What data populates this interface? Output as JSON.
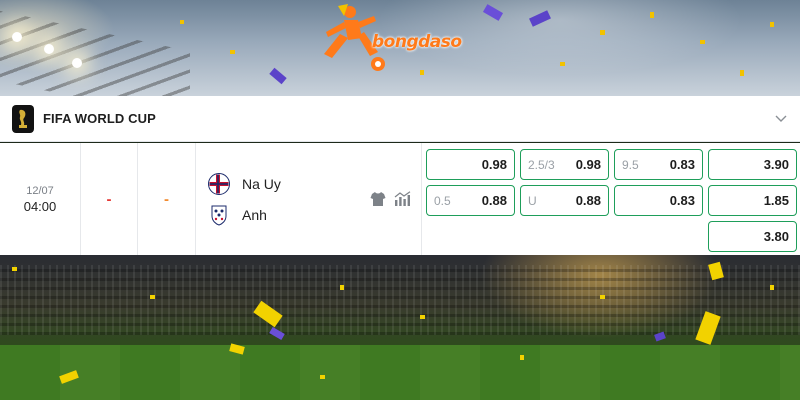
{
  "brand": {
    "name": "bongdaso"
  },
  "league": {
    "title": "FIFA WORLD CUP",
    "icon": "trophy-icon"
  },
  "match": {
    "date": "12/07",
    "time": "04:00",
    "score_home": "-",
    "score_away": "-",
    "home_team": "Na Uy",
    "away_team": "Anh",
    "home_flag_icon": "norway-fa-crest-icon",
    "away_flag_icon": "england-crest-icon"
  },
  "odds": {
    "handicap": {
      "home": {
        "line": "",
        "value": "0.98"
      },
      "away": {
        "line": "0.5",
        "value": "0.88"
      }
    },
    "over_under": {
      "over": {
        "line": "2.5/3",
        "value": "0.98"
      },
      "under": {
        "line": "U",
        "value": "0.88"
      }
    },
    "corners": {
      "over": {
        "line": "9.5",
        "value": "0.83"
      },
      "under": {
        "line": "",
        "value": "0.83"
      }
    },
    "one_x_two": {
      "home": "3.90",
      "draw": "1.85",
      "away": "3.80"
    }
  },
  "colors": {
    "accent": "#1e9e5a",
    "brand": "#ff7a1a",
    "score_dash_1": "#e53935",
    "score_dash_2": "#f28b30"
  }
}
